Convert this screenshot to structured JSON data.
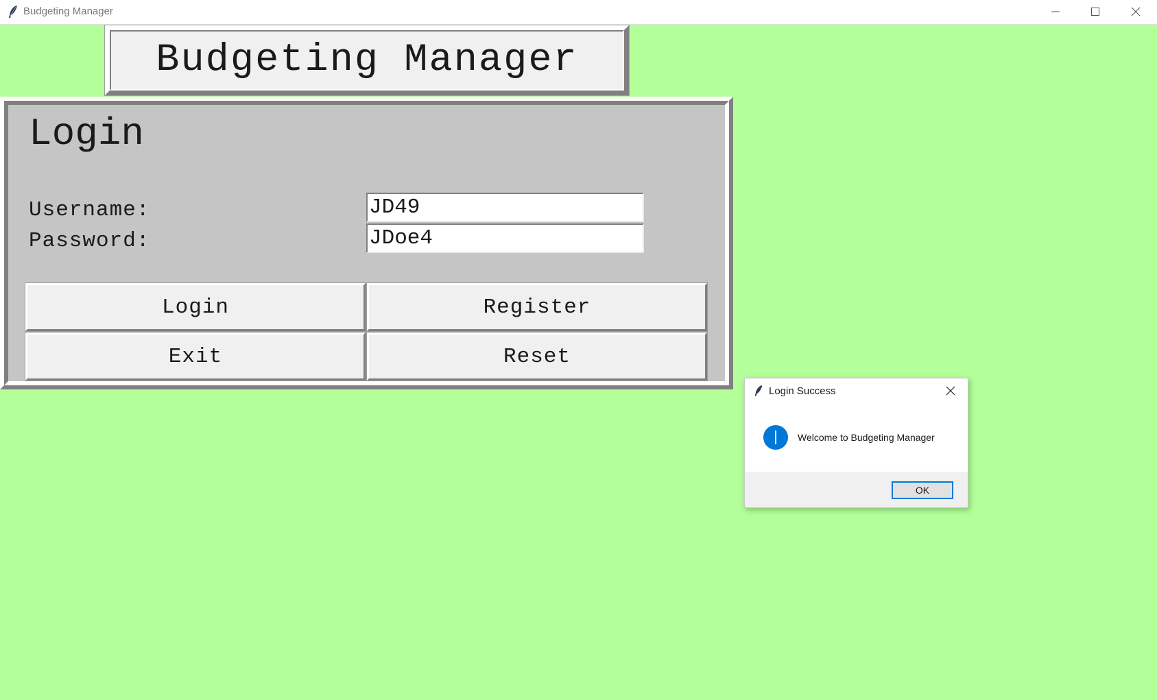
{
  "window": {
    "title": "Budgeting Manager"
  },
  "banner": {
    "title": "Budgeting Manager"
  },
  "login_panel": {
    "heading": "Login",
    "username_label": "Username:",
    "username_value": "JD49",
    "password_label": "Password:",
    "password_value": "JDoe4",
    "buttons": {
      "login": "Login",
      "register": "Register",
      "exit": "Exit",
      "reset": "Reset"
    }
  },
  "dialog": {
    "title": "Login Success",
    "message": "Welcome to Budgeting Manager",
    "ok_label": "OK",
    "icon": "info-icon"
  },
  "colors": {
    "background": "#b3ff99",
    "panel": "#c5c5c5",
    "button_face": "#f0f0f0",
    "info_blue": "#0078d7"
  }
}
